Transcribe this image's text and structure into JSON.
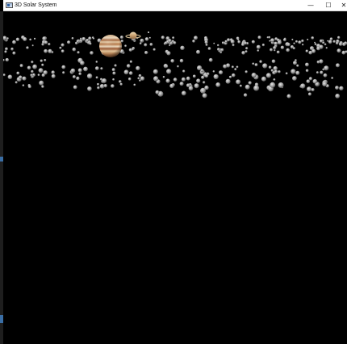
{
  "window": {
    "title": "3D Solar System",
    "icon": "app-window-icon",
    "controls": {
      "minimize_icon": "minimize-icon",
      "maximize_icon": "maximize-icon",
      "close_icon": "close-icon"
    }
  },
  "scene": {
    "background_color": "#000000",
    "objects": [
      "asteroid-belt",
      "planet-jupiter",
      "planet-saturn",
      "star"
    ]
  },
  "colors": {
    "titlebar_bg": "#ffffff",
    "asteroid": "#b8b8b8",
    "jupiter_band_light": "#e8c9a0",
    "jupiter_band_dark": "#a0603a"
  }
}
